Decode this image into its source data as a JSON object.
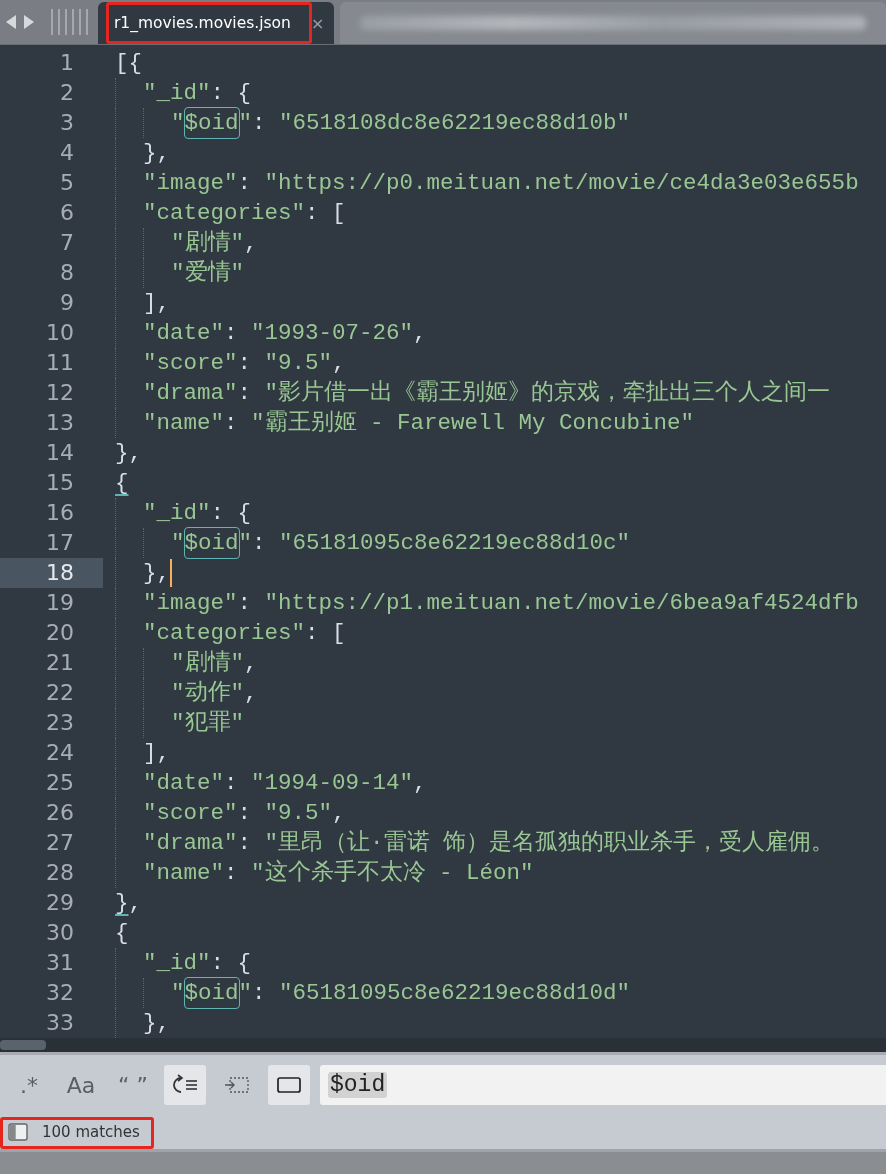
{
  "tabs": [
    {
      "kind": "file",
      "label": "r1_movies.movies.json",
      "close": "×",
      "selected": true,
      "annotated": true
    },
    {
      "kind": "blurred",
      "selected": false
    }
  ],
  "editor": {
    "lines": [
      {
        "number": "1",
        "current": false,
        "parts": [
          {
            "kind": "punct",
            "text": "[{"
          }
        ]
      },
      {
        "number": "2",
        "current": false,
        "parts": [
          {
            "kind": "string",
            "text": "  \"_id\""
          },
          {
            "kind": "punct",
            "text": ": {"
          }
        ]
      },
      {
        "number": "3",
        "current": false,
        "parts": [
          {
            "kind": "string",
            "text": "    \""
          },
          {
            "kind": "match",
            "text": "$oid"
          },
          {
            "kind": "string",
            "text": "\""
          },
          {
            "kind": "punct",
            "text": ": "
          },
          {
            "kind": "string",
            "text": "\"6518108dc8e62219ec88d10b\""
          }
        ]
      },
      {
        "number": "4",
        "current": false,
        "parts": [
          {
            "kind": "punct",
            "text": "  },"
          }
        ]
      },
      {
        "number": "5",
        "current": false,
        "parts": [
          {
            "kind": "string",
            "text": "  \"image\""
          },
          {
            "kind": "punct",
            "text": ": "
          },
          {
            "kind": "string",
            "text": "\"https://p0.meituan.net/movie/ce4da3e03e655b"
          }
        ]
      },
      {
        "number": "6",
        "current": false,
        "parts": [
          {
            "kind": "string",
            "text": "  \"categories\""
          },
          {
            "kind": "punct",
            "text": ": ["
          }
        ]
      },
      {
        "number": "7",
        "current": false,
        "parts": [
          {
            "kind": "string",
            "text": "    \"剧情\""
          },
          {
            "kind": "punct",
            "text": ","
          }
        ]
      },
      {
        "number": "8",
        "current": false,
        "parts": [
          {
            "kind": "string",
            "text": "    \"爱情\""
          }
        ]
      },
      {
        "number": "9",
        "current": false,
        "parts": [
          {
            "kind": "punct",
            "text": "  ],"
          }
        ]
      },
      {
        "number": "10",
        "current": false,
        "parts": [
          {
            "kind": "string",
            "text": "  \"date\""
          },
          {
            "kind": "punct",
            "text": ": "
          },
          {
            "kind": "string",
            "text": "\"1993-07-26\""
          },
          {
            "kind": "punct",
            "text": ","
          }
        ]
      },
      {
        "number": "11",
        "current": false,
        "parts": [
          {
            "kind": "string",
            "text": "  \"score\""
          },
          {
            "kind": "punct",
            "text": ": "
          },
          {
            "kind": "string",
            "text": "\"9.5\""
          },
          {
            "kind": "punct",
            "text": ","
          }
        ]
      },
      {
        "number": "12",
        "current": false,
        "parts": [
          {
            "kind": "string",
            "text": "  \"drama\""
          },
          {
            "kind": "punct",
            "text": ": "
          },
          {
            "kind": "string",
            "text": "\"影片借一出《霸王别姬》的京戏，牵扯出三个人之间一"
          }
        ]
      },
      {
        "number": "13",
        "current": false,
        "parts": [
          {
            "kind": "string",
            "text": "  \"name\""
          },
          {
            "kind": "punct",
            "text": ": "
          },
          {
            "kind": "string",
            "text": "\"霸王别姬 - Farewell My Concubine\""
          }
        ]
      },
      {
        "number": "14",
        "current": false,
        "parts": [
          {
            "kind": "punct",
            "text": "},"
          }
        ]
      },
      {
        "number": "15",
        "current": false,
        "parts": [
          {
            "kind": "bracket",
            "text": "{"
          }
        ]
      },
      {
        "number": "16",
        "current": false,
        "parts": [
          {
            "kind": "string",
            "text": "  \"_id\""
          },
          {
            "kind": "punct",
            "text": ": {"
          }
        ]
      },
      {
        "number": "17",
        "current": false,
        "parts": [
          {
            "kind": "string",
            "text": "    \""
          },
          {
            "kind": "match",
            "text": "$oid"
          },
          {
            "kind": "string",
            "text": "\""
          },
          {
            "kind": "punct",
            "text": ": "
          },
          {
            "kind": "string",
            "text": "\"65181095c8e62219ec88d10c\""
          }
        ]
      },
      {
        "number": "18",
        "current": true,
        "parts": [
          {
            "kind": "punct",
            "text": "  },"
          }
        ]
      },
      {
        "number": "19",
        "current": false,
        "parts": [
          {
            "kind": "string",
            "text": "  \"image\""
          },
          {
            "kind": "punct",
            "text": ": "
          },
          {
            "kind": "string",
            "text": "\"https://p1.meituan.net/movie/6bea9af4524dfb"
          }
        ]
      },
      {
        "number": "20",
        "current": false,
        "parts": [
          {
            "kind": "string",
            "text": "  \"categories\""
          },
          {
            "kind": "punct",
            "text": ": ["
          }
        ]
      },
      {
        "number": "21",
        "current": false,
        "parts": [
          {
            "kind": "string",
            "text": "    \"剧情\""
          },
          {
            "kind": "punct",
            "text": ","
          }
        ]
      },
      {
        "number": "22",
        "current": false,
        "parts": [
          {
            "kind": "string",
            "text": "    \"动作\""
          },
          {
            "kind": "punct",
            "text": ","
          }
        ]
      },
      {
        "number": "23",
        "current": false,
        "parts": [
          {
            "kind": "string",
            "text": "    \"犯罪\""
          }
        ]
      },
      {
        "number": "24",
        "current": false,
        "parts": [
          {
            "kind": "punct",
            "text": "  ],"
          }
        ]
      },
      {
        "number": "25",
        "current": false,
        "parts": [
          {
            "kind": "string",
            "text": "  \"date\""
          },
          {
            "kind": "punct",
            "text": ": "
          },
          {
            "kind": "string",
            "text": "\"1994-09-14\""
          },
          {
            "kind": "punct",
            "text": ","
          }
        ]
      },
      {
        "number": "26",
        "current": false,
        "parts": [
          {
            "kind": "string",
            "text": "  \"score\""
          },
          {
            "kind": "punct",
            "text": ": "
          },
          {
            "kind": "string",
            "text": "\"9.5\""
          },
          {
            "kind": "punct",
            "text": ","
          }
        ]
      },
      {
        "number": "27",
        "current": false,
        "parts": [
          {
            "kind": "string",
            "text": "  \"drama\""
          },
          {
            "kind": "punct",
            "text": ": "
          },
          {
            "kind": "string",
            "text": "\"里昂（让·雷诺 饰）是名孤独的职业杀手，受人雇佣。"
          }
        ]
      },
      {
        "number": "28",
        "current": false,
        "parts": [
          {
            "kind": "string",
            "text": "  \"name\""
          },
          {
            "kind": "punct",
            "text": ": "
          },
          {
            "kind": "string",
            "text": "\"这个杀手不太冷 - Léon\""
          }
        ]
      },
      {
        "number": "29",
        "current": false,
        "parts": [
          {
            "kind": "bracket",
            "text": "}"
          },
          {
            "kind": "punct",
            "text": ","
          }
        ]
      },
      {
        "number": "30",
        "current": false,
        "parts": [
          {
            "kind": "punct",
            "text": "{"
          }
        ]
      },
      {
        "number": "31",
        "current": false,
        "parts": [
          {
            "kind": "string",
            "text": "  \"_id\""
          },
          {
            "kind": "punct",
            "text": ": {"
          }
        ]
      },
      {
        "number": "32",
        "current": false,
        "parts": [
          {
            "kind": "string",
            "text": "    \""
          },
          {
            "kind": "match",
            "text": "$oid"
          },
          {
            "kind": "string",
            "text": "\""
          },
          {
            "kind": "punct",
            "text": ": "
          },
          {
            "kind": "string",
            "text": "\"65181095c8e62219ec88d10d\""
          }
        ]
      },
      {
        "number": "33",
        "current": false,
        "parts": [
          {
            "kind": "punct",
            "text": "  },"
          }
        ]
      }
    ]
  },
  "find": {
    "options": [
      {
        "kind": "regex",
        "label": ".*",
        "selected": false
      },
      {
        "kind": "case",
        "label": "Aa",
        "selected": false
      },
      {
        "kind": "word",
        "label": "“ ”",
        "selected": false
      },
      {
        "kind": "wrap",
        "selected": true
      },
      {
        "kind": "in_selection",
        "selected": false
      },
      {
        "kind": "highlight",
        "selected": true
      }
    ],
    "value": "$oid"
  },
  "status": {
    "text": "100 matches",
    "annotated": true
  }
}
